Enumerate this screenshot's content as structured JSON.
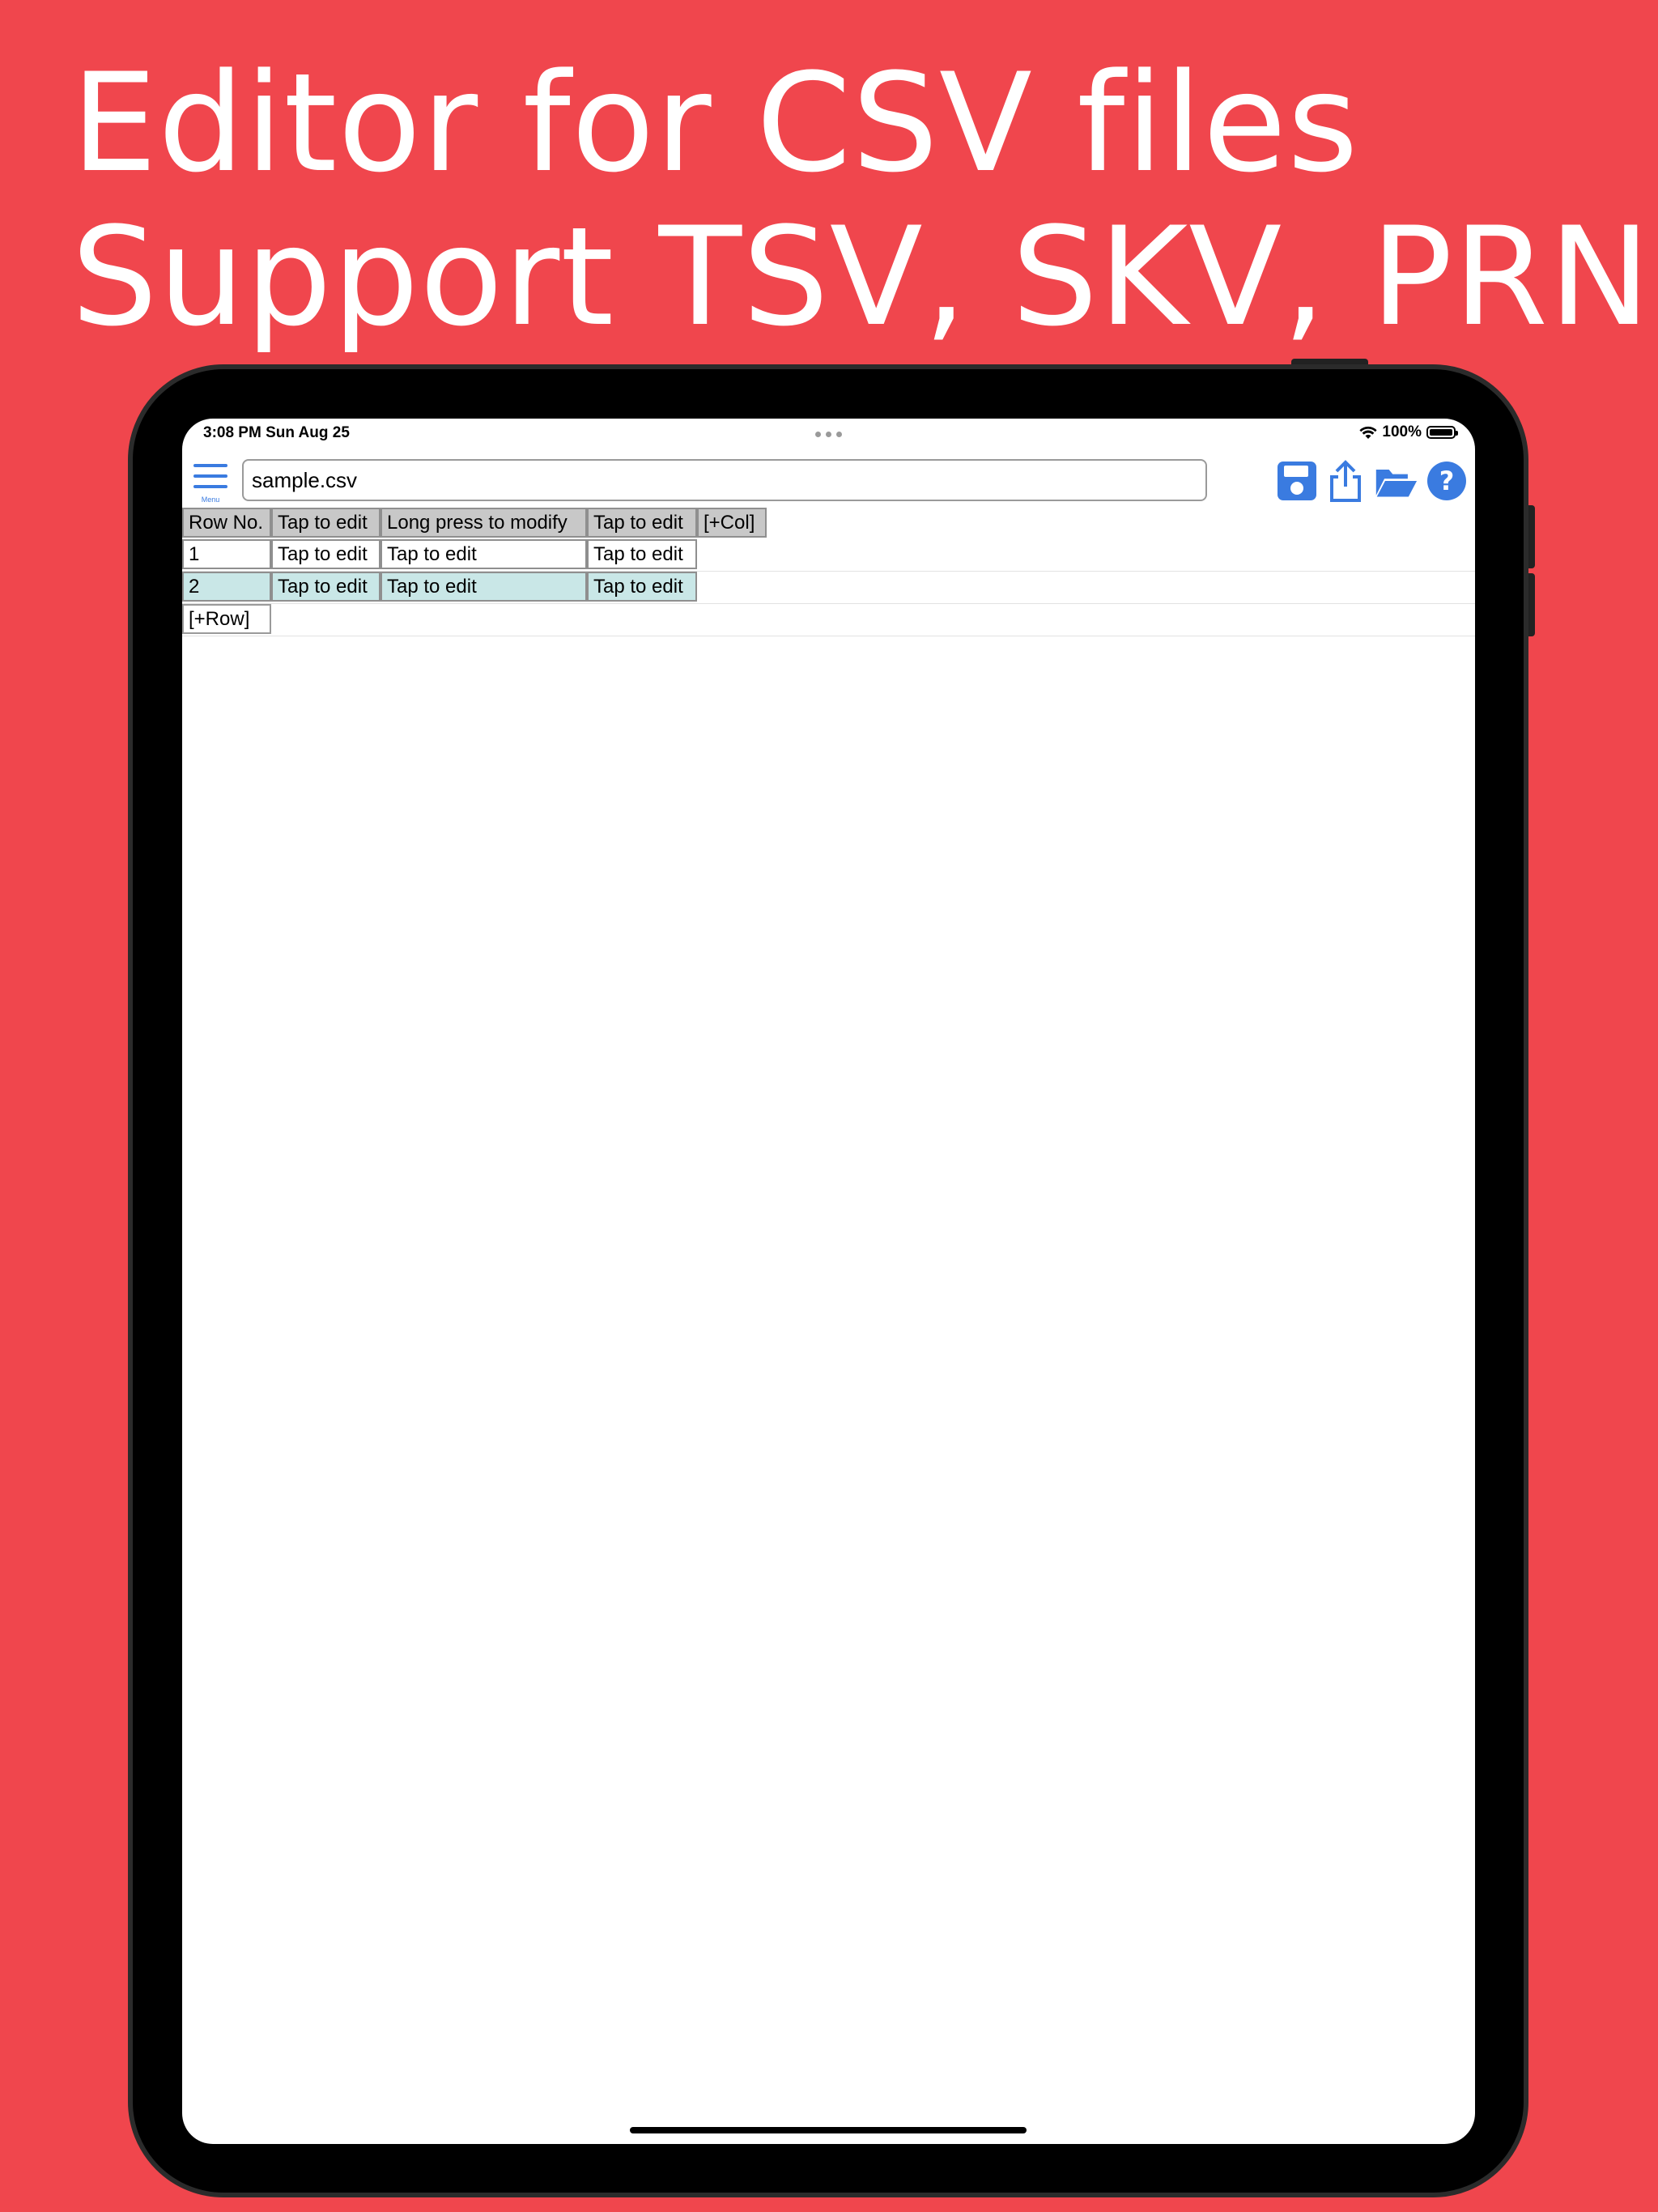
{
  "promo": {
    "line1": "Editor for CSV files",
    "line2": "Support TSV, SKV, PRN"
  },
  "status_bar": {
    "time_date": "3:08 PM   Sun Aug 25",
    "battery": "100%"
  },
  "toolbar": {
    "menu_label": "Menu",
    "file_name": "sample.csv",
    "icons": [
      "save-icon",
      "share-icon",
      "open-folder-icon",
      "help-icon"
    ]
  },
  "table": {
    "headers": [
      "Row No.",
      "Tap to edit",
      "Long press to modify",
      "Tap to edit",
      "[+Col]"
    ],
    "rows": [
      [
        "1",
        "Tap to edit",
        "Tap to edit",
        "Tap to edit"
      ],
      [
        "2",
        "Tap to edit",
        "Tap to edit",
        "Tap to edit"
      ]
    ],
    "add_row_label": "[+Row]"
  },
  "colors": {
    "background": "#f0464d",
    "accent": "#3a7be0",
    "header_cell": "#c8c8c8",
    "highlight_row": "#c9e7e7"
  }
}
